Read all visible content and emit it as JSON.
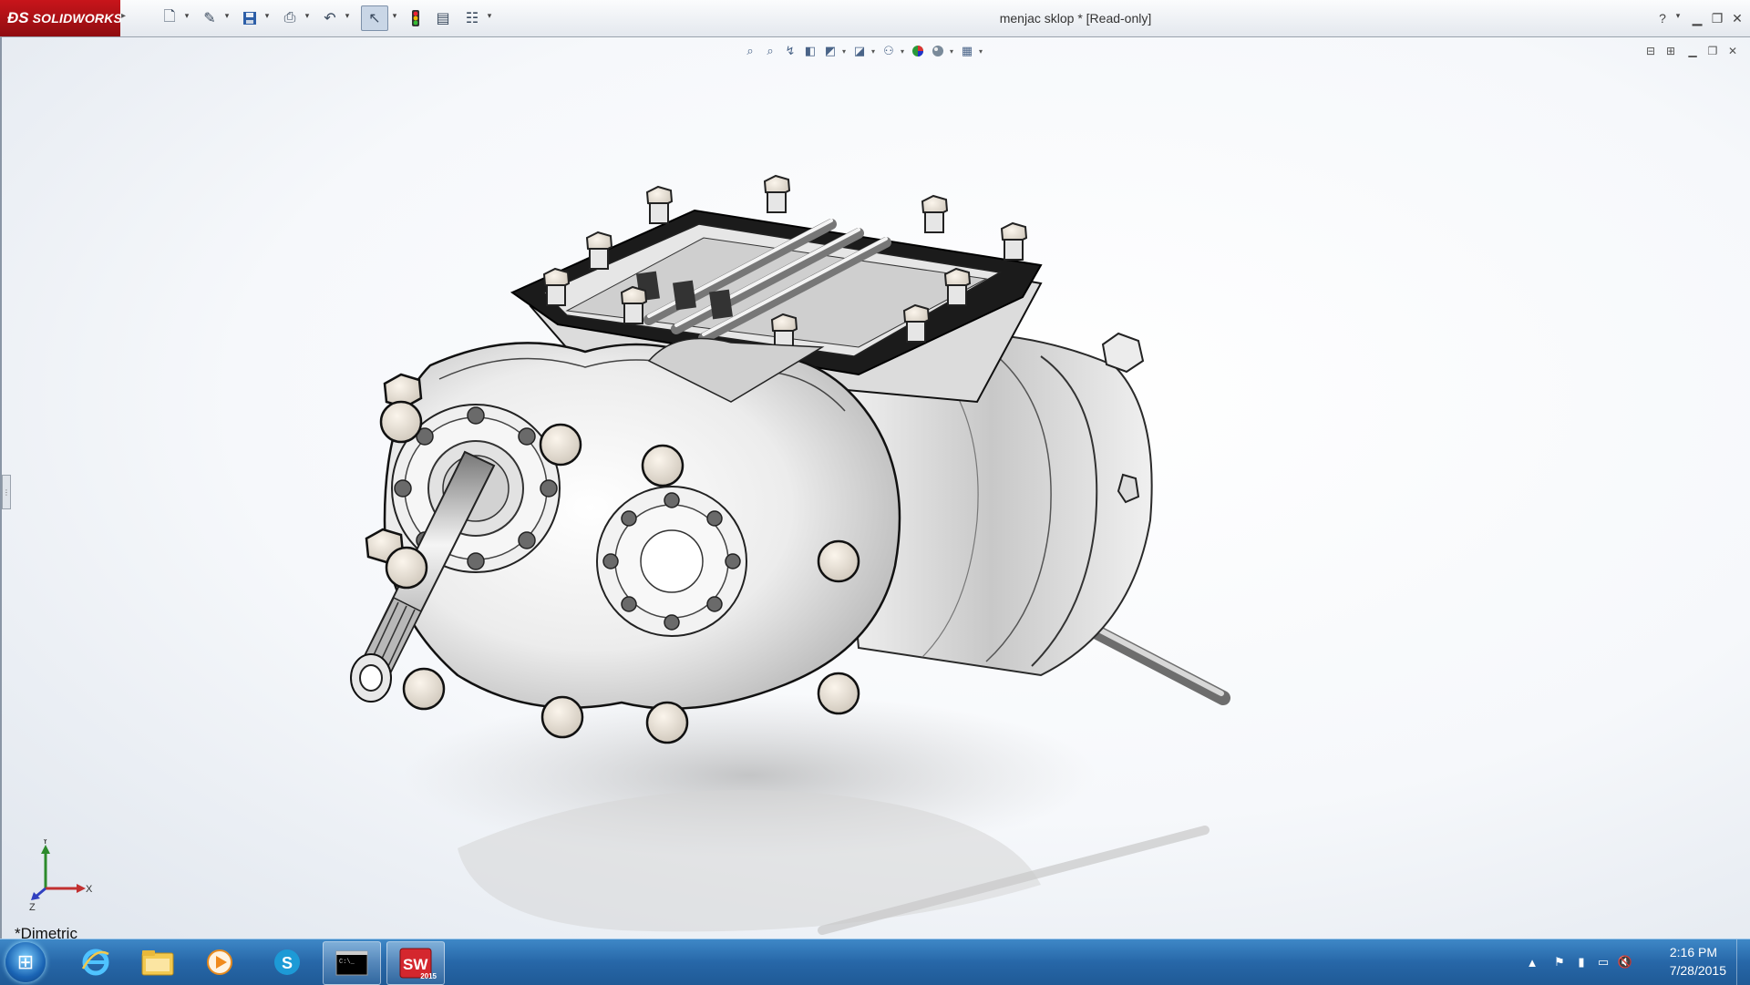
{
  "app": {
    "name": "SOLIDWORKS",
    "document_title": "menjac sklop * [Read-only]"
  },
  "toolbar": {
    "icons": [
      "new-document-icon",
      "open-icon",
      "save-icon",
      "print-icon",
      "undo-icon",
      "select-icon",
      "rebuild-icon",
      "file-properties-icon",
      "options-icon"
    ]
  },
  "heads_up_toolbar": {
    "icons": [
      "zoom-to-fit-icon",
      "zoom-to-area-icon",
      "previous-view-icon",
      "section-view-icon",
      "view-orientation-icon",
      "display-style-icon",
      "hide-show-items-icon",
      "edit-appearance-icon",
      "apply-scene-icon",
      "view-settings-icon"
    ]
  },
  "viewport": {
    "view_name": "*Dimetric",
    "triad": {
      "x_label": "X",
      "y_label": "Y",
      "z_label": "Z"
    }
  },
  "taskbar": {
    "pinned": [
      "Internet Explorer",
      "Windows Explorer",
      "Windows Media Player",
      "Skype",
      "Command Prompt",
      "SOLIDWORKS 2015"
    ],
    "solidworks_badge": "2015",
    "clock": {
      "time": "2:16 PM",
      "date": "7/28/2015"
    }
  }
}
